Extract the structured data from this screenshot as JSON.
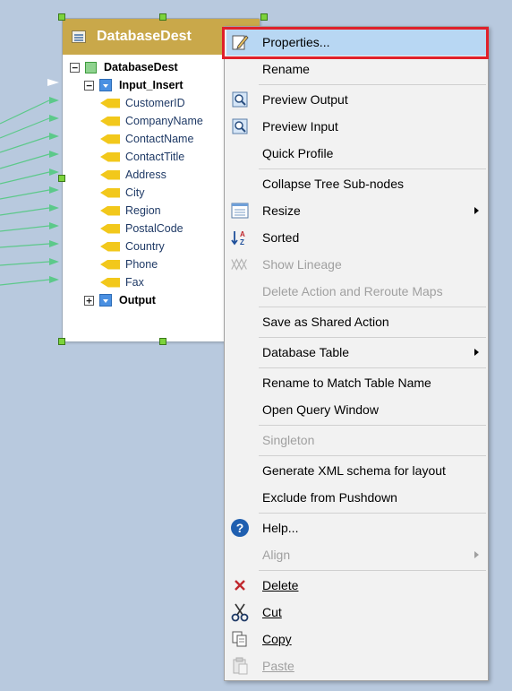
{
  "component": {
    "title": "DatabaseDest",
    "root_label": "DatabaseDest",
    "input_label": "Input_Insert",
    "output_label": "Output",
    "fields": [
      "CustomerID",
      "CompanyName",
      "ContactName",
      "ContactTitle",
      "Address",
      "City",
      "Region",
      "PostalCode",
      "Country",
      "Phone",
      "Fax"
    ]
  },
  "menu": {
    "properties": "Properties...",
    "rename": "Rename",
    "preview_output": "Preview Output",
    "preview_input": "Preview Input",
    "quick_profile": "Quick Profile",
    "collapse_tree": "Collapse Tree Sub-nodes",
    "resize": "Resize",
    "sorted": "Sorted",
    "show_lineage": "Show Lineage",
    "delete_action": "Delete Action and Reroute Maps",
    "save_shared": "Save as Shared Action",
    "database_table": "Database Table",
    "rename_match": "Rename to Match Table Name",
    "open_query": "Open Query Window",
    "singleton": "Singleton",
    "generate_xml": "Generate XML schema for layout",
    "exclude_pushdown": "Exclude from Pushdown",
    "help": "Help...",
    "align": "Align",
    "delete": "Delete",
    "cut": "Cut",
    "copy": "Copy",
    "paste": "Paste"
  },
  "colors": {
    "canvas": "#b8c9de",
    "header": "#c9a84a",
    "highlight": "#b8d7f3",
    "callout": "#e0202a"
  }
}
